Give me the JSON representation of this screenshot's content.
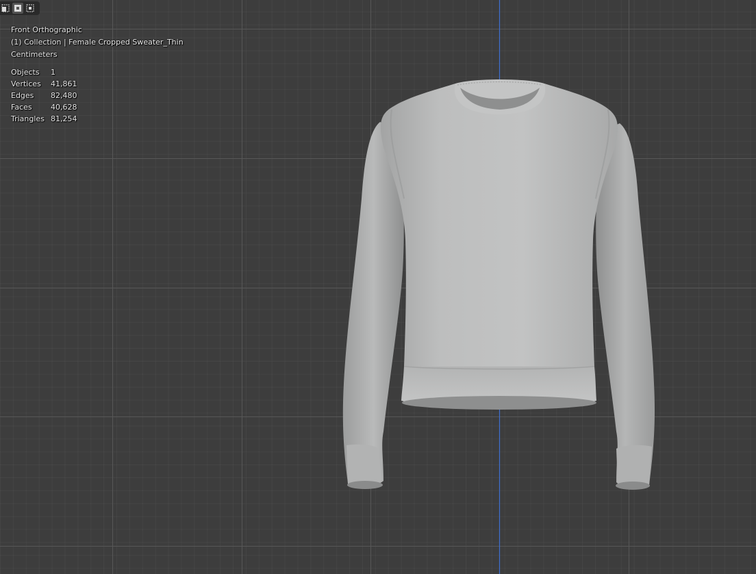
{
  "viewport": {
    "view_name": "Front Orthographic",
    "collection_line": "(1) Collection | Female Cropped Sweater_Thin",
    "units": "Centimeters",
    "axis_color": "#3f6fd0",
    "grid_major_color": "#555555",
    "background_color": "#3d3d3d",
    "model_color": "#b8b9b9"
  },
  "mode_buttons": [
    {
      "icon": "select-box-new-icon"
    },
    {
      "icon": "select-box-extend-icon"
    },
    {
      "icon": "select-box-subtract-icon"
    }
  ],
  "stats": {
    "objects": {
      "label": "Objects",
      "value": "1"
    },
    "vertices": {
      "label": "Vertices",
      "value": "41,861"
    },
    "edges": {
      "label": "Edges",
      "value": "82,480"
    },
    "faces": {
      "label": "Faces",
      "value": "40,628"
    },
    "triangles": {
      "label": "Triangles",
      "value": "81,254"
    }
  }
}
